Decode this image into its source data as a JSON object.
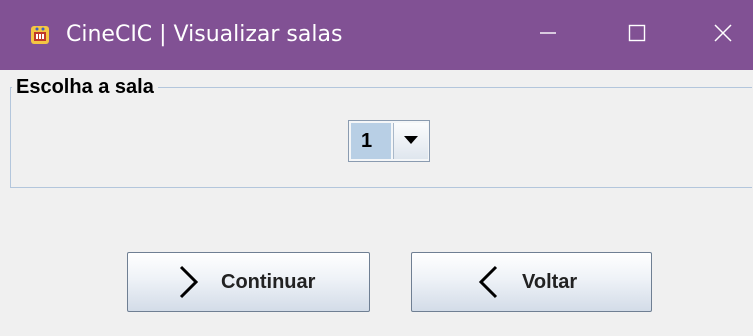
{
  "window": {
    "title": "CineCIC | Visualizar salas",
    "icon": "cinema-app-icon",
    "controls": [
      "minimize-icon",
      "maximize-icon",
      "close-icon"
    ],
    "titlebar_color": "#815194"
  },
  "room_panel": {
    "legend": "Escolha a sala",
    "combo": {
      "selected": "1",
      "arrow_icon": "chevron-down-icon"
    }
  },
  "buttons": {
    "continue_label": "Continuar",
    "continue_icon": "chevron-right-icon",
    "back_label": "Voltar",
    "back_icon": "chevron-left-icon"
  }
}
